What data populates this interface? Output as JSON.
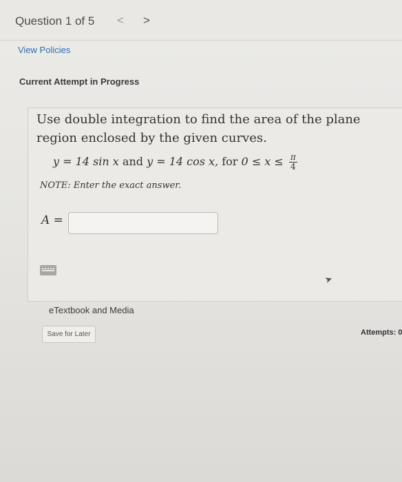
{
  "header": {
    "question_counter": "Question 1 of 5",
    "prev_arrow": "<",
    "next_arrow": ">"
  },
  "policies_link": "View Policies",
  "attempt_heading": "Current Attempt in Progress",
  "problem": {
    "statement": "Use double integration to find the area of the plane region enclosed by the given curves.",
    "eq_part1": "y = 14 sin x",
    "eq_and1": "and",
    "eq_part2": "y = 14 cos x,",
    "eq_for": "for",
    "eq_range": "0 ≤ x ≤",
    "frac_num": "π",
    "frac_den": "4",
    "note": "NOTE: Enter the exact answer."
  },
  "answer": {
    "label": "A =",
    "value": ""
  },
  "etextbook_label": "eTextbook and Media",
  "save_button": "Save for Later",
  "attempts_text": "Attempts: 0",
  "icons": {
    "keyboard": "keyboard-icon",
    "cursor": "mouse-cursor-icon"
  }
}
